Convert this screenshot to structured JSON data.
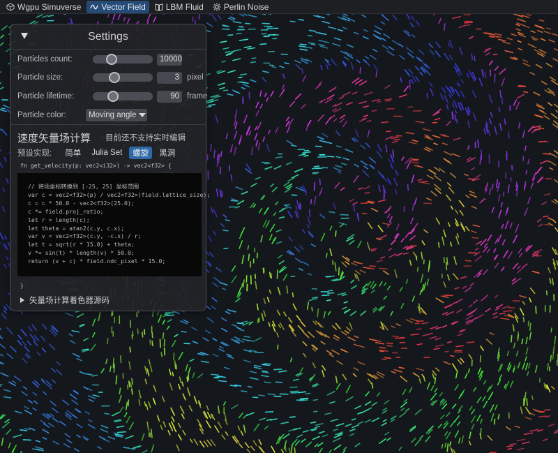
{
  "tabs": [
    {
      "label": "Wgpu Simuverse",
      "icon": "cube-icon",
      "active": false
    },
    {
      "label": "Vector Field",
      "icon": "wave-icon",
      "active": true
    },
    {
      "label": "LBM Fluid",
      "icon": "book-icon",
      "active": false
    },
    {
      "label": "Perlin Noise",
      "icon": "gear-icon",
      "active": false
    }
  ],
  "settings": {
    "title": "Settings",
    "particles_count": {
      "label": "Particles count:",
      "value": "10000",
      "level": 0.27
    },
    "particle_size": {
      "label": "Particle size:",
      "value": "3",
      "unit": "pixel",
      "level": 0.33
    },
    "particle_lifetime": {
      "label": "Particle lifetime:",
      "value": "90",
      "unit": "frame",
      "level": 0.3
    },
    "particle_color": {
      "label": "Particle color:",
      "value": "Moving angle"
    }
  },
  "velocity": {
    "title": "速度矢量场计算",
    "note": "目前还不支持实时编辑",
    "presets_label": "预设实现:",
    "presets": [
      "简单",
      "Julia Set",
      "螺旋",
      "黑洞"
    ],
    "selected_preset": "螺旋",
    "fn_signature": "fn get_velocity(p: vec2<i32>) -> vec2<f32> {",
    "code_lines": [
      "// 将场坐标转换到 [-25, 25] 坐标范围",
      "var c = vec2<f32>(p) / vec2<f32>(field.lattice_size);",
      "c = c * 50.0 - vec2<f32>(25.0);",
      "c *= field.proj_ratio;",
      "let r = length(c);",
      "let theta = atan2(c.y, c.x);",
      "var v = vec2<f32>(c.y, -c.x) / r;",
      "let t = sqrt(r * 15.0) + theta;",
      "v *= sin(t) * length(v) * 50.0;",
      "return (v + c) * field.ndc_pixel * 15.0;"
    ],
    "closing_brace": "}",
    "source_toggle": "矢量场计算着色器源码"
  },
  "colors": {
    "tab_active": "#254a75",
    "preset_selected": "#2f68a6",
    "keyword": "#e07060",
    "type": "#59a7e8"
  }
}
